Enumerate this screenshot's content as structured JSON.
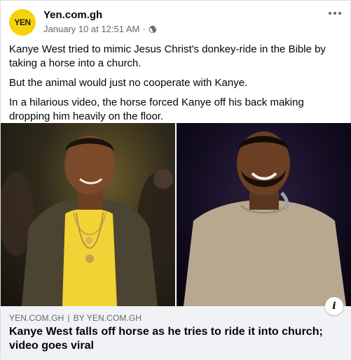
{
  "post": {
    "page_name": "Yen.com.gh",
    "avatar_text": "YEN",
    "timestamp": "January 10 at 12:51 AM",
    "separator": "·",
    "privacy_icon": "globe-icon",
    "more_icon": "ellipsis-icon",
    "paragraphs": [
      "Kanye West tried to mimic Jesus Christ's donkey-ride in the Bible by taking a horse into a church.",
      "But the animal would just no cooperate with Kanye.",
      "In a hilarious video, the horse forced Kanye off his back making dropping him heavily on the floor."
    ]
  },
  "link": {
    "domain": "YEN.COM.GH",
    "divider": "|",
    "byline": "BY YEN.COM.GH",
    "title": "Kanye West falls off horse as he tries to ride it into church; video goes viral",
    "info_icon": "info-icon",
    "info_glyph": "i"
  },
  "colors": {
    "avatar_bg": "#f6d20b",
    "caption_bg": "#f0f2f5",
    "secondary_text": "#65676b",
    "primary_text": "#050505"
  }
}
